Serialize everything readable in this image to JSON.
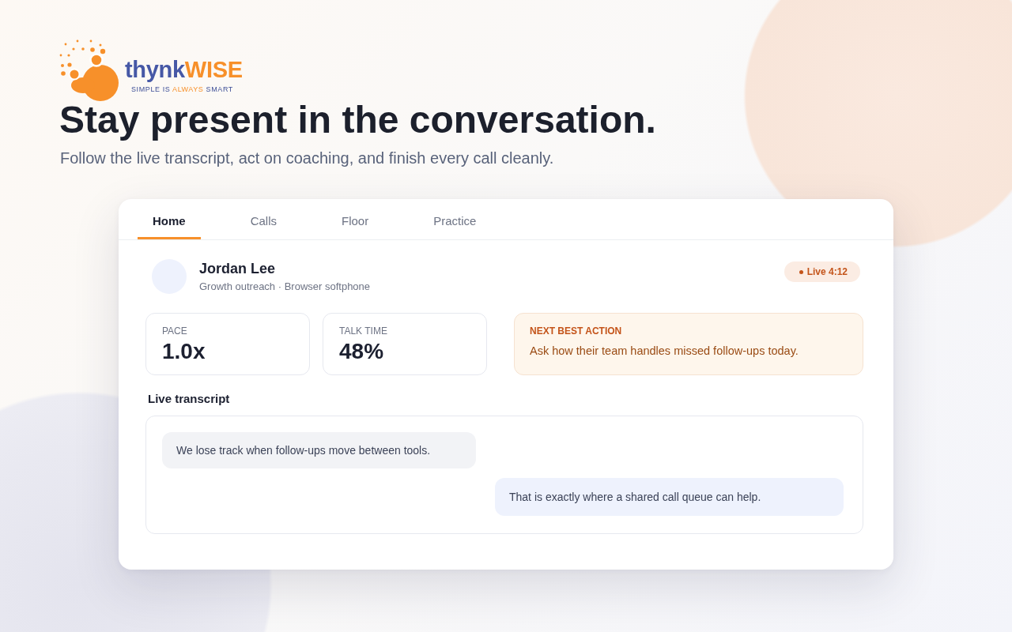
{
  "logo": {
    "wordmark": [
      {
        "text": "thynk",
        "accent": false
      },
      {
        "text": "WISE",
        "accent": true
      }
    ],
    "tagline": [
      {
        "text": "SIMPLE IS ",
        "accent": false
      },
      {
        "text": "ALWAYS",
        "accent": true
      },
      {
        "text": " SMART",
        "accent": false
      }
    ]
  },
  "hero": {
    "title": "Stay present in the conversation.",
    "subtitle": "Follow the live transcript, act on coaching, and finish every call cleanly."
  },
  "app": {
    "tabs": [
      {
        "label": "Home",
        "selected": true
      },
      {
        "label": "Calls",
        "selected": false
      },
      {
        "label": "Floor",
        "selected": false
      },
      {
        "label": "Practice",
        "selected": false
      }
    ],
    "contact": {
      "name": "Jordan Lee",
      "detail": "Growth outreach · Browser softphone",
      "status": "Live 4:12"
    },
    "stats": [
      {
        "label": "PACE",
        "value": "1.0x"
      },
      {
        "label": "TALK TIME",
        "value": "48%"
      }
    ],
    "next_best_action": {
      "label": "NEXT BEST ACTION",
      "text": "Ask how their team handles missed follow-ups today."
    },
    "transcript": {
      "title": "Live transcript",
      "messages": [
        {
          "kind": "customer",
          "text": "We lose track when follow-ups move between tools."
        },
        {
          "kind": "agent",
          "text": "That is exactly where a shared call queue can help."
        }
      ]
    }
  }
}
